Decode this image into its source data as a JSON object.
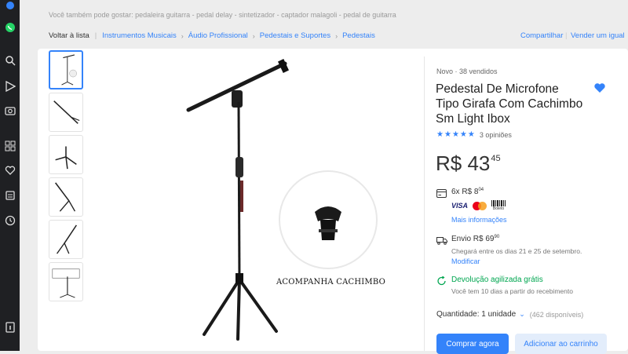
{
  "suggestions": "Você também pode gostar: pedaleira guitarra - pedal delay - sintetizador - captador malagoli - pedal de guitarra",
  "breadcrumb": {
    "back": "Voltar à lista",
    "items": [
      "Instrumentos Musicais",
      "Áudio Profissional",
      "Pedestais e Suportes",
      "Pedestais"
    ]
  },
  "actions": {
    "share": "Compartilhar",
    "sell": "Vender um igual"
  },
  "product": {
    "condition": "Novo  ·  38 vendidos",
    "title": "Pedestal De Microfone Tipo Girafa Com Cachimbo Sm Light Ibox",
    "rating": 5,
    "reviews": "3 opiniões",
    "price_currency": "R$ 43",
    "price_cents": "45",
    "image_caption": "ACOMPANHA CACHIMBO"
  },
  "payment": {
    "installments": "6x R$ 8",
    "installments_cents": "04",
    "visa": "VISA",
    "boleto": "Boleto",
    "more_info": "Mais informações"
  },
  "shipping": {
    "label": "Envio R$ 69",
    "cents": "90",
    "arrival": "Chegará entre os dias 21 e 25 de setembro.",
    "modify": "Modificar"
  },
  "returns": {
    "label": "Devolução agilizada grátis",
    "detail": "Você tem 10 dias a partir do recebimento"
  },
  "quantity": {
    "label": "Quantidade: 1 unidade",
    "available": "(462 disponíveis)"
  },
  "buttons": {
    "buy": "Comprar agora",
    "cart": "Adicionar ao carrinho"
  },
  "colors": {
    "accent": "#3483fa",
    "green": "#00a650",
    "sidebar": "#1f2023"
  },
  "sidebar_icons": [
    "app-logo-icon",
    "whatsapp-icon",
    "search-icon",
    "send-icon",
    "camera-icon",
    "grid-icon",
    "heart-icon",
    "wallet-icon",
    "history-icon",
    "info-icon"
  ]
}
